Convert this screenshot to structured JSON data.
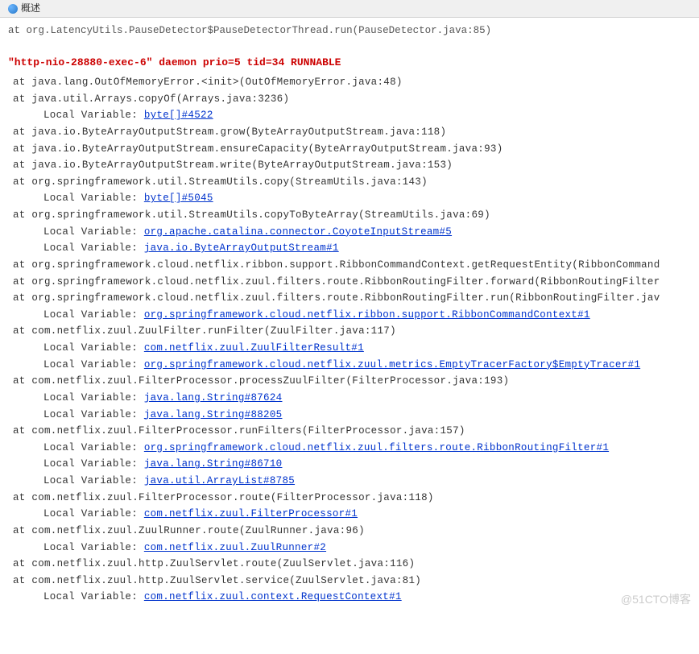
{
  "tab": {
    "label": "概述"
  },
  "truncated_top": "at org.LatencyUtils.PauseDetector$PauseDetectorThread.run(PauseDetector.java:85)",
  "thread_header": "\"http-nio-28880-exec-6\" daemon prio=5 tid=34 RUNNABLE",
  "stack": [
    {
      "type": "at",
      "text": "at java.lang.OutOfMemoryError.<init>(OutOfMemoryError.java:48)"
    },
    {
      "type": "at",
      "text": "at java.util.Arrays.copyOf(Arrays.java:3236)"
    },
    {
      "type": "local",
      "prefix": "Local Variable: ",
      "link": "byte[]#4522"
    },
    {
      "type": "at",
      "text": "at java.io.ByteArrayOutputStream.grow(ByteArrayOutputStream.java:118)"
    },
    {
      "type": "at",
      "text": "at java.io.ByteArrayOutputStream.ensureCapacity(ByteArrayOutputStream.java:93)"
    },
    {
      "type": "at",
      "text": "at java.io.ByteArrayOutputStream.write(ByteArrayOutputStream.java:153)"
    },
    {
      "type": "at",
      "text": "at org.springframework.util.StreamUtils.copy(StreamUtils.java:143)"
    },
    {
      "type": "local",
      "prefix": "Local Variable: ",
      "link": "byte[]#5045"
    },
    {
      "type": "at",
      "text": "at org.springframework.util.StreamUtils.copyToByteArray(StreamUtils.java:69)"
    },
    {
      "type": "local",
      "prefix": "Local Variable: ",
      "link": "org.apache.catalina.connector.CoyoteInputStream#5"
    },
    {
      "type": "local",
      "prefix": "Local Variable: ",
      "link": "java.io.ByteArrayOutputStream#1"
    },
    {
      "type": "at",
      "text": "at org.springframework.cloud.netflix.ribbon.support.RibbonCommandContext.getRequestEntity(RibbonCommand"
    },
    {
      "type": "at",
      "text": "at org.springframework.cloud.netflix.zuul.filters.route.RibbonRoutingFilter.forward(RibbonRoutingFilter"
    },
    {
      "type": "at",
      "text": "at org.springframework.cloud.netflix.zuul.filters.route.RibbonRoutingFilter.run(RibbonRoutingFilter.jav"
    },
    {
      "type": "local",
      "prefix": "Local Variable: ",
      "link": "org.springframework.cloud.netflix.ribbon.support.RibbonCommandContext#1"
    },
    {
      "type": "at",
      "text": "at com.netflix.zuul.ZuulFilter.runFilter(ZuulFilter.java:117)"
    },
    {
      "type": "local",
      "prefix": "Local Variable: ",
      "link": "com.netflix.zuul.ZuulFilterResult#1"
    },
    {
      "type": "local",
      "prefix": "Local Variable: ",
      "link": "org.springframework.cloud.netflix.zuul.metrics.EmptyTracerFactory$EmptyTracer#1"
    },
    {
      "type": "at",
      "text": "at com.netflix.zuul.FilterProcessor.processZuulFilter(FilterProcessor.java:193)"
    },
    {
      "type": "local",
      "prefix": "Local Variable: ",
      "link": "java.lang.String#87624"
    },
    {
      "type": "local",
      "prefix": "Local Variable: ",
      "link": "java.lang.String#88205"
    },
    {
      "type": "at",
      "text": "at com.netflix.zuul.FilterProcessor.runFilters(FilterProcessor.java:157)"
    },
    {
      "type": "local",
      "prefix": "Local Variable: ",
      "link": "org.springframework.cloud.netflix.zuul.filters.route.RibbonRoutingFilter#1"
    },
    {
      "type": "local",
      "prefix": "Local Variable: ",
      "link": "java.lang.String#86710"
    },
    {
      "type": "local",
      "prefix": "Local Variable: ",
      "link": "java.util.ArrayList#8785"
    },
    {
      "type": "at",
      "text": "at com.netflix.zuul.FilterProcessor.route(FilterProcessor.java:118)"
    },
    {
      "type": "local",
      "prefix": "Local Variable: ",
      "link": "com.netflix.zuul.FilterProcessor#1"
    },
    {
      "type": "at",
      "text": "at com.netflix.zuul.ZuulRunner.route(ZuulRunner.java:96)"
    },
    {
      "type": "local",
      "prefix": "Local Variable: ",
      "link": "com.netflix.zuul.ZuulRunner#2"
    },
    {
      "type": "at",
      "text": "at com.netflix.zuul.http.ZuulServlet.route(ZuulServlet.java:116)"
    },
    {
      "type": "at",
      "text": "at com.netflix.zuul.http.ZuulServlet.service(ZuulServlet.java:81)"
    },
    {
      "type": "local",
      "prefix": "Local Variable: ",
      "link": "com.netflix.zuul.context.RequestContext#1"
    }
  ],
  "watermark": "@51CTO博客"
}
